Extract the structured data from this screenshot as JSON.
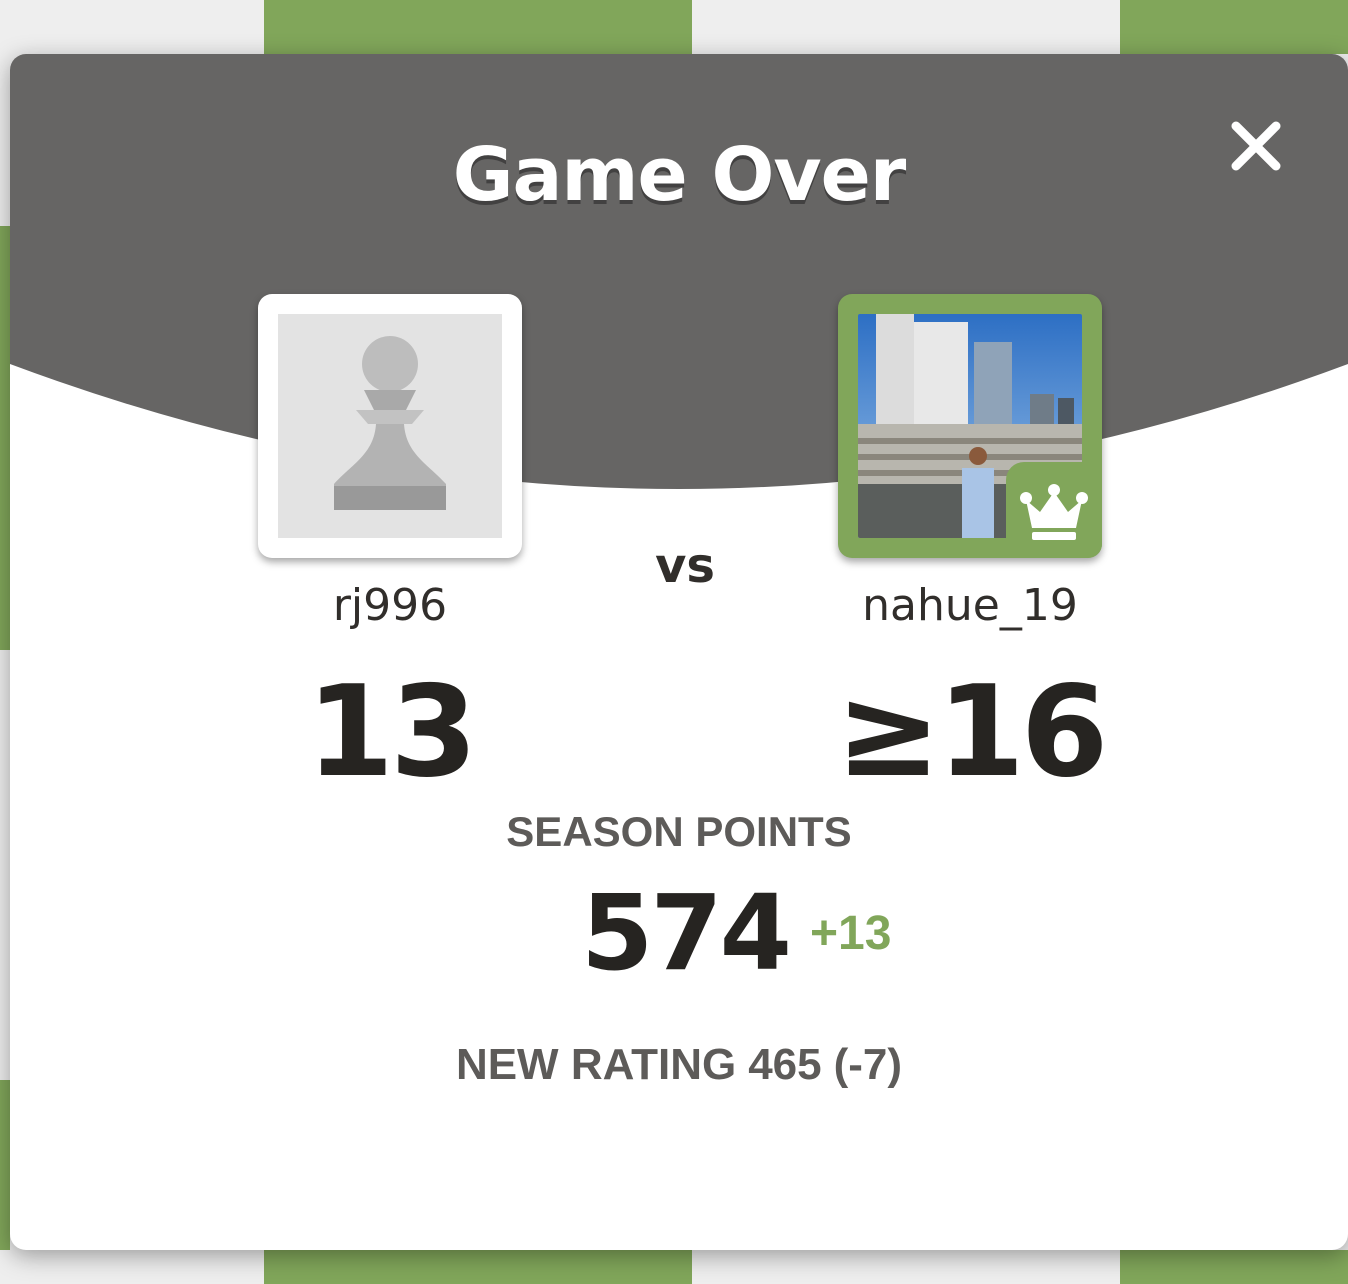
{
  "colors": {
    "header_bg": "#666564",
    "accent_green": "#81a65a",
    "board_light": "#eeeeee",
    "text_dark": "#262421",
    "text_muted": "#5d5b59"
  },
  "modal": {
    "title": "Game Over",
    "close_icon": "close-icon"
  },
  "players": {
    "left": {
      "username": "rj996",
      "score": "13",
      "avatar_icon": "pawn-icon"
    },
    "right": {
      "username": "nahue_19",
      "score": "≥16",
      "avatar_icon": "profile-photo",
      "badge_icon": "crown-icon"
    },
    "vs_label": "vs"
  },
  "season": {
    "label": "SEASON POINTS",
    "value": "574",
    "delta": "+13"
  },
  "rating": {
    "label": "NEW RATING",
    "value": "465",
    "change": "(-7)"
  }
}
